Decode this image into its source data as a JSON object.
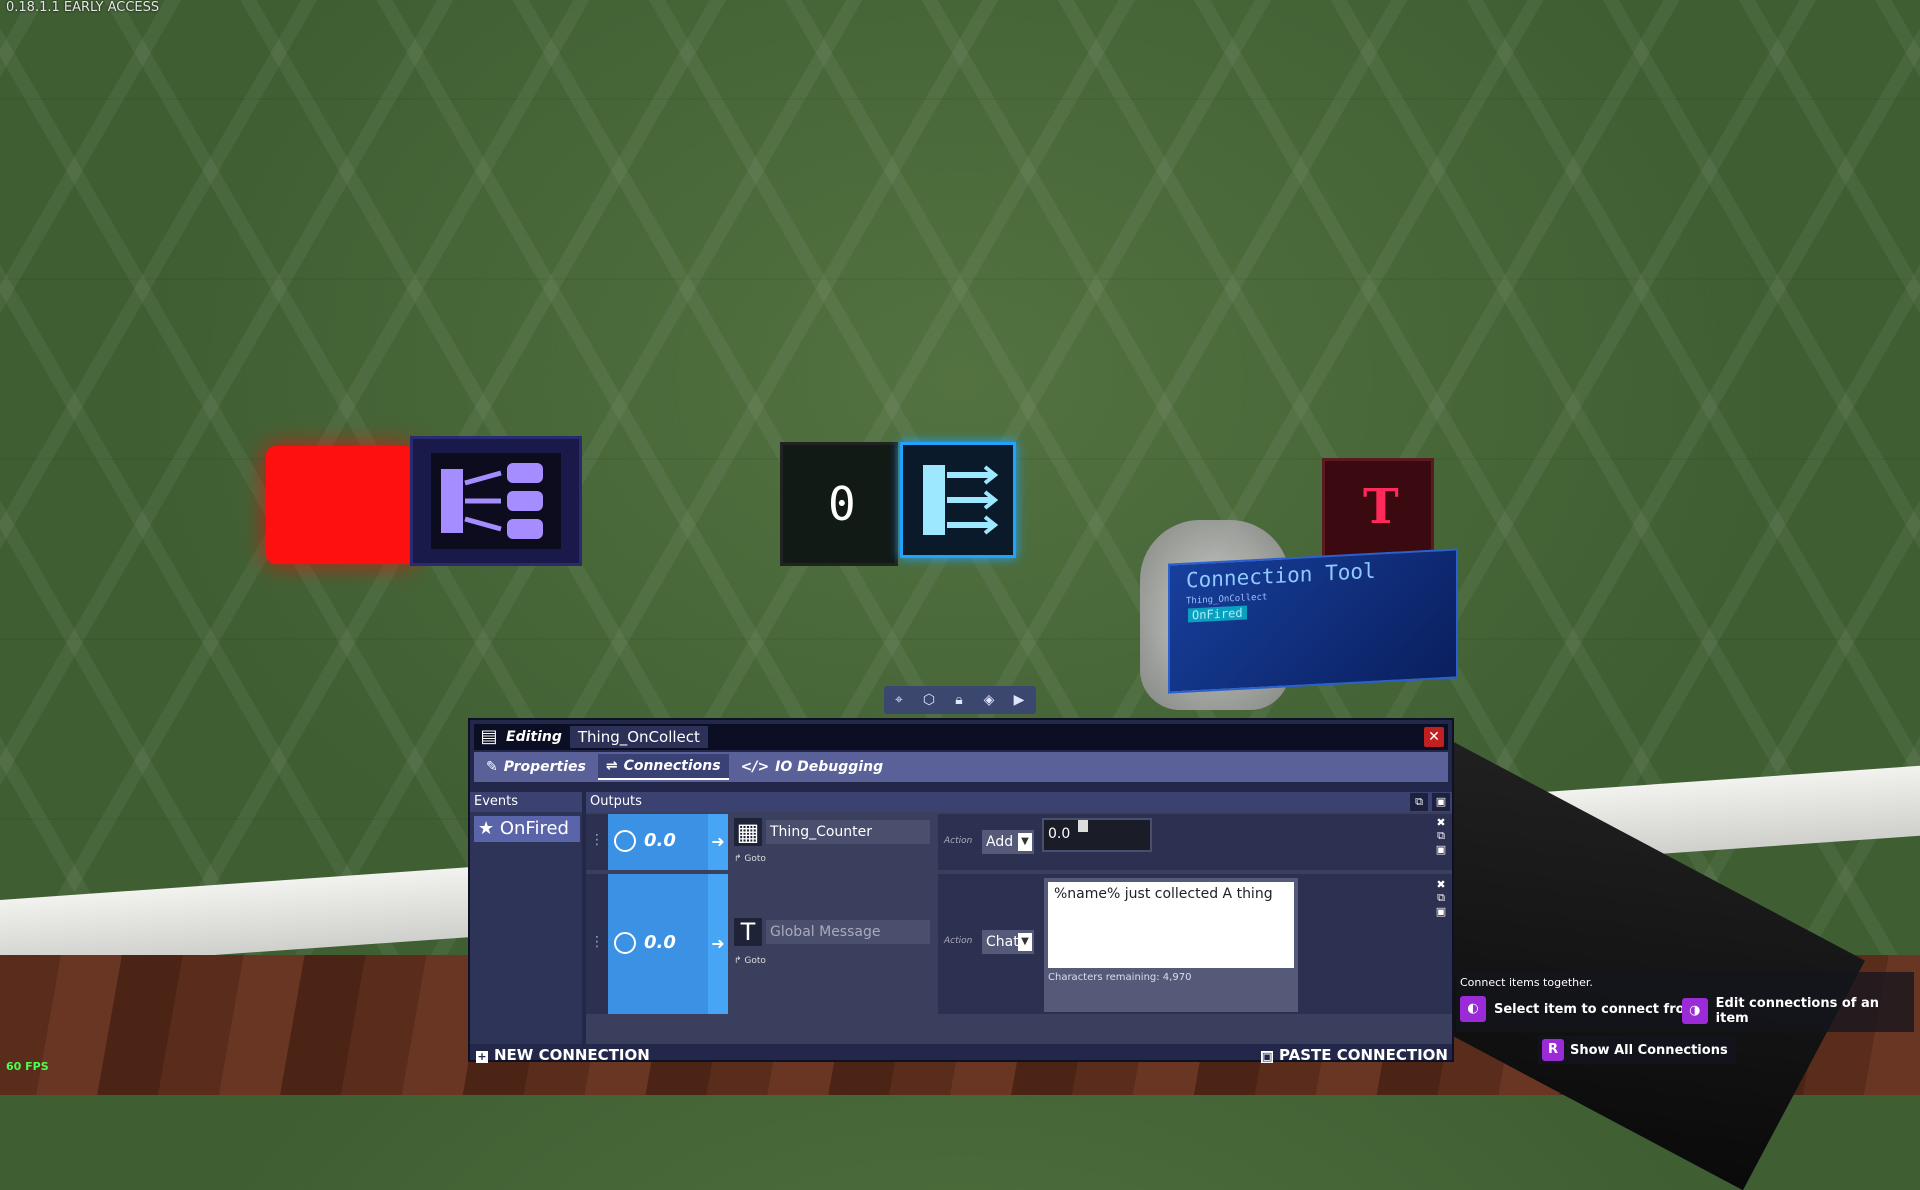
{
  "hud": {
    "version": "0.18.1.1 EARLY ACCESS",
    "fps": "60 FPS"
  },
  "world": {
    "counter_digit": "0",
    "text_block_letter": "T",
    "tool": {
      "title": "Connection Tool",
      "subtitle": "Thing_OnCollect",
      "event": "OnFired"
    }
  },
  "toolbar": {
    "icons": [
      "tag-icon",
      "box-open-icon",
      "lock-icon",
      "cube-icon",
      "cursor-icon"
    ]
  },
  "editor": {
    "title_label": "Editing",
    "item_name": "Thing_OnCollect",
    "close": "✕",
    "tabs": [
      {
        "label": "Properties",
        "icon": "brush-icon"
      },
      {
        "label": "Connections",
        "icon": "link-icon",
        "active": true
      },
      {
        "label": "IO Debugging",
        "icon": "code-icon"
      }
    ],
    "events_header": "Events",
    "events": [
      {
        "label": "OnFired"
      }
    ],
    "outputs_header": "Outputs",
    "outputs": [
      {
        "delay": "0.0",
        "target": "Thing_Counter",
        "goto": "Goto",
        "action_label": "Action",
        "action": "Add",
        "param": "0.0",
        "param_level": 0.35
      },
      {
        "delay": "0.0",
        "target": "Global Message",
        "goto": "Goto",
        "action_label": "Action",
        "action": "Chat",
        "message": "%name% just collected A thing",
        "remaining": "Characters remaining: 4,970"
      }
    ],
    "new_connection": "NEW CONNECTION",
    "paste_connection": "PASTE CONNECTION"
  },
  "hints": {
    "top": "Connect items together.",
    "select": "Select item to connect from",
    "edit": "Edit connections of an item",
    "show_key": "R",
    "show_all": "Show All Connections"
  },
  "colors": {
    "accent": "#3b91e3",
    "panel": "#23284a",
    "hint_key": "#9a2bd6",
    "red_block": "#ff1010"
  }
}
